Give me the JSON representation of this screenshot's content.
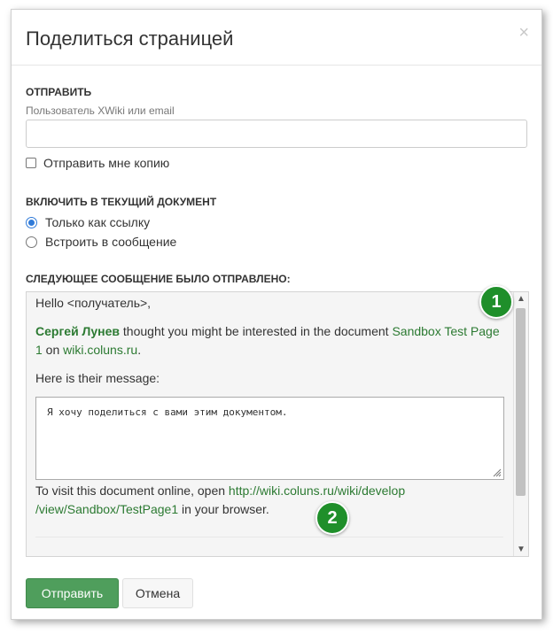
{
  "dialog": {
    "title": "Поделиться страницей",
    "close_label": "×"
  },
  "send_section": {
    "heading": "ОТПРАВИТЬ",
    "hint": "Пользователь XWiki или email",
    "recipient_value": "",
    "copy_label": "Отправить мне копию",
    "copy_checked": false
  },
  "include_section": {
    "heading": "ВКЛЮЧИТЬ В ТЕКУЩИЙ ДОКУМЕНТ",
    "options": [
      {
        "label": "Только как ссылку",
        "selected": true
      },
      {
        "label": "Встроить в сообщение",
        "selected": false
      }
    ]
  },
  "preview": {
    "heading": "СЛЕДУЮЩЕЕ СООБЩЕНИЕ БЫЛО ОТПРАВЛЕНО:",
    "greeting": "Hello <получатель>,",
    "sender_name": "Сергей Лунев",
    "thought_text": " thought you might be interested in the document ",
    "doc_link": "Sandbox Test Page 1",
    "on_text": " on ",
    "site_link": "wiki.coluns.ru",
    "period": ".",
    "their_message_label": "Here is their message:",
    "message_text": "Я хочу поделиться с вами этим документом.",
    "visit_text": "To visit this document online, open ",
    "url_part1": "http://wiki.coluns.ru/wiki/develop",
    "url_part2": "/view/Sandbox/TestPage1",
    "browser_text": " in your browser."
  },
  "badges": [
    "1",
    "2"
  ],
  "buttons": {
    "send": "Отправить",
    "cancel": "Отмена"
  },
  "colors": {
    "link_green": "#2c7a32",
    "badge_green": "#1f8f2a",
    "primary_button": "#4f9e5c",
    "radio_blue": "#2f7ad8"
  }
}
